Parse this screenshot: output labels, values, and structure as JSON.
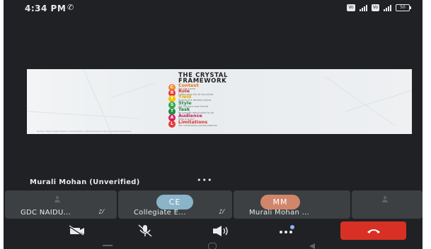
{
  "status_bar": {
    "time": "4:34 PM",
    "icons": [
      "phone-call-icon",
      "volte-icon",
      "signal-icon",
      "battery-icon"
    ],
    "battery": "50"
  },
  "slide": {
    "title_line1": "THE CRYSTAL",
    "title_line2": "FRAMEWORK",
    "items": [
      {
        "letter": "C",
        "name": "Context",
        "desc": "Set the scene",
        "color": "#f28b30",
        "text_color": "#e8710a"
      },
      {
        "letter": "R",
        "name": "Role",
        "desc": "Define who the AI should be",
        "color": "#e53935",
        "text_color": "#d93025"
      },
      {
        "letter": "Y",
        "name": "Yield",
        "desc": "Specify the desired output",
        "color": "#f2c200",
        "text_color": "#e0a800"
      },
      {
        "letter": "S",
        "name": "Style",
        "desc": "Set the tone and format",
        "color": "#34a853",
        "text_color": "#1e8e3e"
      },
      {
        "letter": "T",
        "name": "Task",
        "desc": "Be specific about what to do",
        "color": "#1e8e3e",
        "text_color": "#188038"
      },
      {
        "letter": "A",
        "name": "Audience",
        "desc": "Who is it for?",
        "color": "#d81b60",
        "text_color": "#c2185b"
      },
      {
        "letter": "L",
        "name": "Limitations",
        "desc": "Set constraints and boundaries",
        "color": "#e53935",
        "text_color": "#d93025"
      }
    ],
    "source": "Source: https://www.linkedin.com/pulse/the-crystal-framework-an-ai-prompt-engineering"
  },
  "presenter": {
    "name": "Murali Mohan (Unverified)",
    "more": "•••"
  },
  "participants": [
    {
      "name": "GDC NAIDU...",
      "avatar": "",
      "avatar_color": "",
      "muted": true
    },
    {
      "name": "Collegiate E...",
      "avatar": "CE",
      "avatar_color": "#8ab4c8",
      "muted": true
    },
    {
      "name": "Murali Mohan ...",
      "avatar": "MM",
      "avatar_color": "#d0866b",
      "muted": false
    },
    {
      "name": "",
      "avatar": "",
      "avatar_color": "",
      "muted": false
    }
  ],
  "controls": [
    "camera-off-button",
    "mic-off-button",
    "speaker-button",
    "more-options-button",
    "end-call-button"
  ],
  "colors": {
    "background": "#202124",
    "tile": "#3c4043",
    "end_call": "#d93025",
    "accent_blue": "#8ab4f8"
  }
}
